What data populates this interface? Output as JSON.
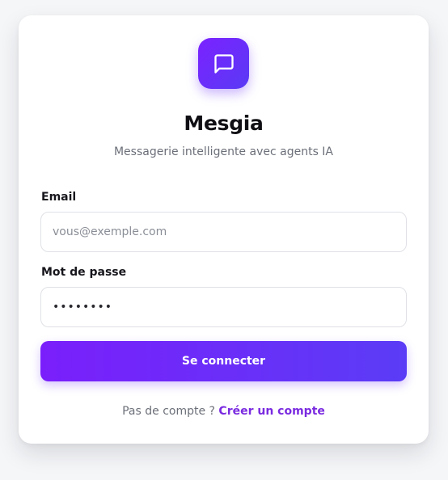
{
  "app": {
    "title": "Mesgia",
    "subtitle": "Messagerie intelligente avec agents IA",
    "logo_icon": "message-square-icon"
  },
  "form": {
    "email_label": "Email",
    "email_placeholder": "vous@exemple.com",
    "email_value": "",
    "password_label": "Mot de passe",
    "password_value": "pass1234",
    "submit_label": "Se connecter"
  },
  "footer": {
    "prompt": "Pas de compte ?",
    "link_label": "Créer un compte"
  },
  "colors": {
    "accent": "#7a1ffb",
    "accent_end": "#5b3cf6",
    "link": "#7a2be0",
    "background": "#f5f6f8"
  }
}
